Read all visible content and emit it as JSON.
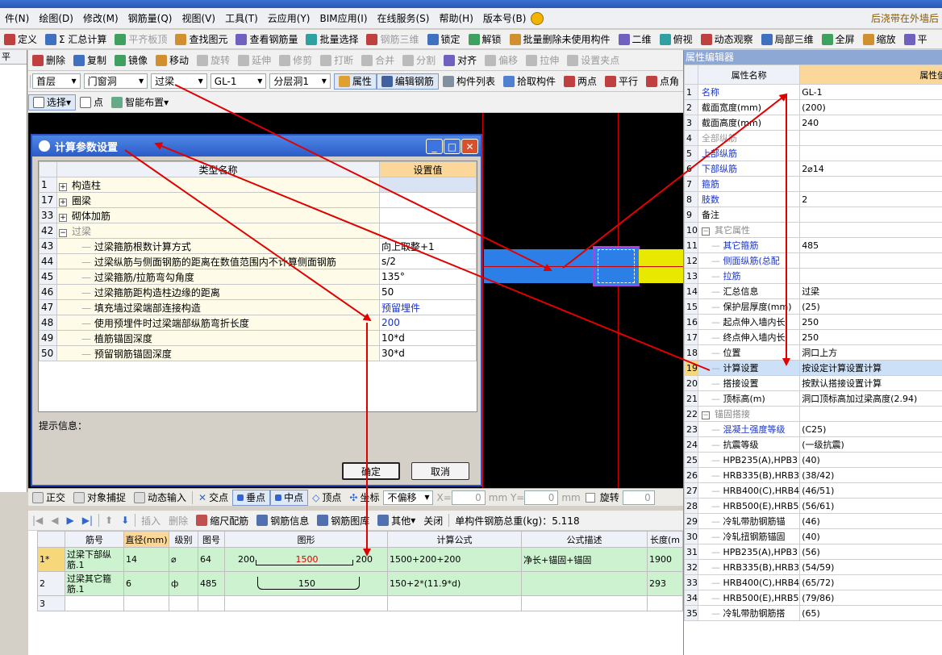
{
  "menubar": {
    "items": [
      "件(N)",
      "绘图(D)",
      "修改(M)",
      "钢筋量(Q)",
      "视图(V)",
      "工具(T)",
      "云应用(Y)",
      "BIM应用(I)",
      "在线服务(S)",
      "帮助(H)",
      "版本号(B)"
    ],
    "notice": "后浇带在外墙后"
  },
  "toolbar1": [
    "定义",
    "Σ 汇总计算",
    "平齐板顶",
    "查找图元",
    "查看钢筋量",
    "批量选择",
    "钢筋三维",
    "锁定",
    "解锁",
    "批量删除未使用构件",
    "二维",
    "俯视",
    "动态观察",
    "局部三维",
    "全屏",
    "缩放",
    "平"
  ],
  "toolbar2": [
    "删除",
    "复制",
    "镜像",
    "移动",
    "旋转",
    "延伸",
    "修剪",
    "打断",
    "合并",
    "分割",
    "对齐",
    "偏移",
    "拉伸",
    "设置夹点"
  ],
  "toolbar3": {
    "floor": "首层",
    "category": "门窗洞",
    "type": "过梁",
    "component": "GL-1",
    "layer": "分层洞1",
    "buttons": [
      "属性",
      "编辑钢筋",
      "构件列表",
      "拾取构件",
      "两点",
      "平行",
      "点角"
    ]
  },
  "toolbar4": [
    "选择",
    "点",
    "智能布置"
  ],
  "left_tab": "平",
  "dialog": {
    "title": "计算参数设置",
    "col_type": "类型名称",
    "col_value": "设置值",
    "rows": [
      {
        "num": "1",
        "name": "构造柱",
        "value": "",
        "group": true,
        "sign": "+"
      },
      {
        "num": "17",
        "name": "圈梁",
        "value": "",
        "group": true,
        "sign": "+"
      },
      {
        "num": "33",
        "name": "砌体加筋",
        "value": "",
        "group": true,
        "sign": "+"
      },
      {
        "num": "42",
        "name": "过梁",
        "value": "",
        "group": true,
        "sign": "−"
      },
      {
        "num": "43",
        "name": "过梁箍筋根数计算方式",
        "value": "向上取整+1"
      },
      {
        "num": "44",
        "name": "过梁纵筋与侧面钢筋的距离在数值范围内不计算侧面钢筋",
        "value": "s/2"
      },
      {
        "num": "45",
        "name": "过梁箍筋/拉筋弯勾角度",
        "value": "135°"
      },
      {
        "num": "46",
        "name": "过梁箍筋距构造柱边缘的距离",
        "value": "50"
      },
      {
        "num": "47",
        "name": "填充墙过梁端部连接构造",
        "value": "预留埋件",
        "blue": true
      },
      {
        "num": "48",
        "name": "使用预埋件时过梁端部纵筋弯折长度",
        "value": "200",
        "blue": true
      },
      {
        "num": "49",
        "name": "植筋锚固深度",
        "value": "10*d"
      },
      {
        "num": "50",
        "name": "预留钢筋锚固深度",
        "value": "30*d"
      }
    ],
    "hint_label": "提示信息：",
    "ok": "确定",
    "cancel": "取消"
  },
  "property_editor": {
    "title": "属性编辑器",
    "col_name": "属性名称",
    "col_value": "属性值",
    "rows": [
      {
        "num": "1",
        "name": "名称",
        "value": "GL-1",
        "style": "blue"
      },
      {
        "num": "2",
        "name": "截面宽度(mm)",
        "value": "(200)"
      },
      {
        "num": "3",
        "name": "截面高度(mm)",
        "value": "240"
      },
      {
        "num": "4",
        "name": "全部纵筋",
        "value": "",
        "style": "grey"
      },
      {
        "num": "5",
        "name": "上部纵筋",
        "value": "",
        "style": "blue"
      },
      {
        "num": "6",
        "name": "下部纵筋",
        "value": "2⌀14",
        "style": "blue"
      },
      {
        "num": "7",
        "name": "箍筋",
        "value": "",
        "style": "blue"
      },
      {
        "num": "8",
        "name": "肢数",
        "value": "2",
        "style": "blue"
      },
      {
        "num": "9",
        "name": "备注",
        "value": ""
      },
      {
        "num": "10",
        "name": "其它属性",
        "value": "",
        "group": true
      },
      {
        "num": "11",
        "name": "其它箍筋",
        "value": "485",
        "style": "blue",
        "indent": true
      },
      {
        "num": "12",
        "name": "侧面纵筋(总配",
        "value": "",
        "style": "blue",
        "indent": true
      },
      {
        "num": "13",
        "name": "拉筋",
        "value": "",
        "style": "blue",
        "indent": true
      },
      {
        "num": "14",
        "name": "汇总信息",
        "value": "过梁",
        "indent": true
      },
      {
        "num": "15",
        "name": "保护层厚度(mm)",
        "value": "(25)",
        "indent": true
      },
      {
        "num": "16",
        "name": "起点伸入墙内长",
        "value": "250",
        "indent": true
      },
      {
        "num": "17",
        "name": "终点伸入墙内长",
        "value": "250",
        "indent": true
      },
      {
        "num": "18",
        "name": "位置",
        "value": "洞口上方",
        "indent": true
      },
      {
        "num": "19",
        "name": "计算设置",
        "value": "按设定计算设置计算",
        "indent": true,
        "highlight": true
      },
      {
        "num": "20",
        "name": "搭接设置",
        "value": "按默认搭接设置计算",
        "indent": true
      },
      {
        "num": "21",
        "name": "顶标高(m)",
        "value": "洞口顶标高加过梁高度(2.94)",
        "indent": true
      },
      {
        "num": "22",
        "name": "锚固搭接",
        "value": "",
        "group": true
      },
      {
        "num": "23",
        "name": "混凝土强度等级",
        "value": "(C25)",
        "style": "blue",
        "indent": true
      },
      {
        "num": "24",
        "name": "抗震等级",
        "value": "(一级抗震)",
        "indent": true
      },
      {
        "num": "25",
        "name": "HPB235(A),HPB3",
        "value": "(40)",
        "indent": true
      },
      {
        "num": "26",
        "name": "HRB335(B),HRB3",
        "value": "(38/42)",
        "indent": true
      },
      {
        "num": "27",
        "name": "HRB400(C),HRB4",
        "value": "(46/51)",
        "indent": true
      },
      {
        "num": "28",
        "name": "HRB500(E),HRB5",
        "value": "(56/61)",
        "indent": true
      },
      {
        "num": "29",
        "name": "冷轧带肋钢筋锚",
        "value": "(46)",
        "indent": true
      },
      {
        "num": "30",
        "name": "冷轧扭钢筋锚固",
        "value": "(40)",
        "indent": true
      },
      {
        "num": "31",
        "name": "HPB235(A),HPB3",
        "value": "(56)",
        "indent": true
      },
      {
        "num": "32",
        "name": "HRB335(B),HRB3",
        "value": "(54/59)",
        "indent": true
      },
      {
        "num": "33",
        "name": "HRB400(C),HRB4",
        "value": "(65/72)",
        "indent": true
      },
      {
        "num": "34",
        "name": "HRB500(E),HRB5",
        "value": "(79/86)",
        "indent": true
      },
      {
        "num": "35",
        "name": "冷轧带肋钢筋搭",
        "value": "(65)",
        "indent": true
      }
    ]
  },
  "statusbar": {
    "items": [
      "正交",
      "对象捕捉",
      "动态输入",
      "交点",
      "垂点",
      "中点",
      "顶点",
      "坐标"
    ],
    "offset_mode": "不偏移",
    "x_label": "X=",
    "x_value": "0",
    "y_label": "mm  Y=",
    "y_value": "0",
    "unit": "mm",
    "rotate": "旋转",
    "rotate_value": "0"
  },
  "rebar_toolbar": {
    "items": [
      "插入",
      "删除",
      "缩尺配筋",
      "钢筋信息",
      "钢筋图库",
      "其他",
      "关闭"
    ],
    "total_label": "单构件钢筋总重(kg)：5.118"
  },
  "rebar_table": {
    "headers": [
      "",
      "筋号",
      "直径(mm)",
      "级别",
      "图号",
      "图形",
      "计算公式",
      "公式描述",
      "长度(m"
    ],
    "rows": [
      {
        "idx": "1*",
        "name": "过梁下部纵筋.1",
        "dia": "14",
        "grade": "⌀",
        "fig": "64",
        "shape_left": "200",
        "shape_mid": "1500",
        "shape_right": "200",
        "formula": "1500+200+200",
        "desc": "净长+锚固+锚固",
        "len": "1900"
      },
      {
        "idx": "2",
        "name": "过梁其它箍筋.1",
        "dia": "6",
        "grade": "ф",
        "fig": "485",
        "shape_left": "",
        "shape_mid": "150",
        "shape_right": "",
        "formula": "150+2*(11.9*d)",
        "desc": "",
        "len": "293"
      },
      {
        "idx": "3",
        "name": "",
        "dia": "",
        "grade": "",
        "fig": "",
        "shape_left": "",
        "shape_mid": "",
        "shape_right": "",
        "formula": "",
        "desc": "",
        "len": ""
      }
    ]
  },
  "colors": {
    "accent": "#2b5bc8",
    "header_orange": "#fbd89a",
    "arrow_red": "#e00000",
    "beam_blue": "#2b7fe6",
    "beam_yellow": "#e8e800"
  }
}
